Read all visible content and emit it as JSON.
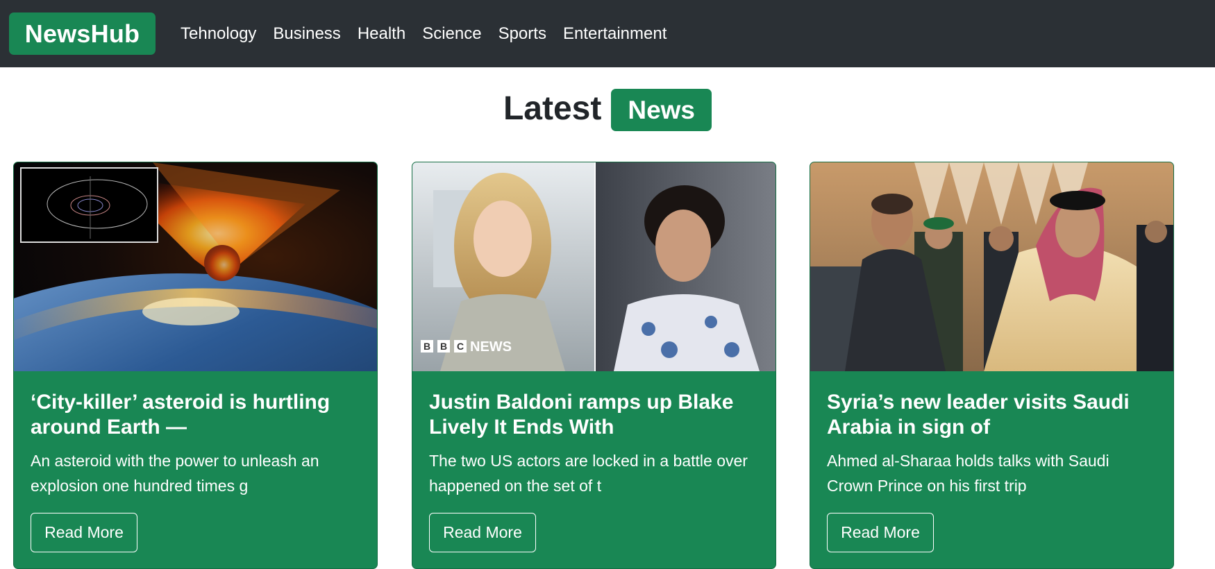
{
  "navbar": {
    "brand": "NewsHub",
    "links": [
      "Tehnology",
      "Business",
      "Health",
      "Science",
      "Sports",
      "Entertainment"
    ]
  },
  "heading": {
    "text": "Latest",
    "badge": "News"
  },
  "cards": [
    {
      "title": "‘City-killer’ asteroid is hurtling around Earth —",
      "text": "An asteroid with the power to unleash an explosion one hundred times g",
      "button": "Read More",
      "image": "asteroid-earth-image"
    },
    {
      "title": "Justin Baldoni ramps up Blake Lively It Ends With",
      "text": "The two US actors are locked in a battle over happened on the set of t",
      "button": "Read More",
      "image": "actors-portrait-image",
      "watermark": "BBC NEWS"
    },
    {
      "title": "Syria’s new leader visits Saudi Arabia in sign of",
      "text": "Ahmed al-Sharaa holds talks with Saudi Crown Prince on his first trip",
      "button": "Read More",
      "image": "leaders-handshake-image"
    }
  ],
  "colors": {
    "brand_green": "#198754",
    "navbar_dark": "#2b3035"
  }
}
